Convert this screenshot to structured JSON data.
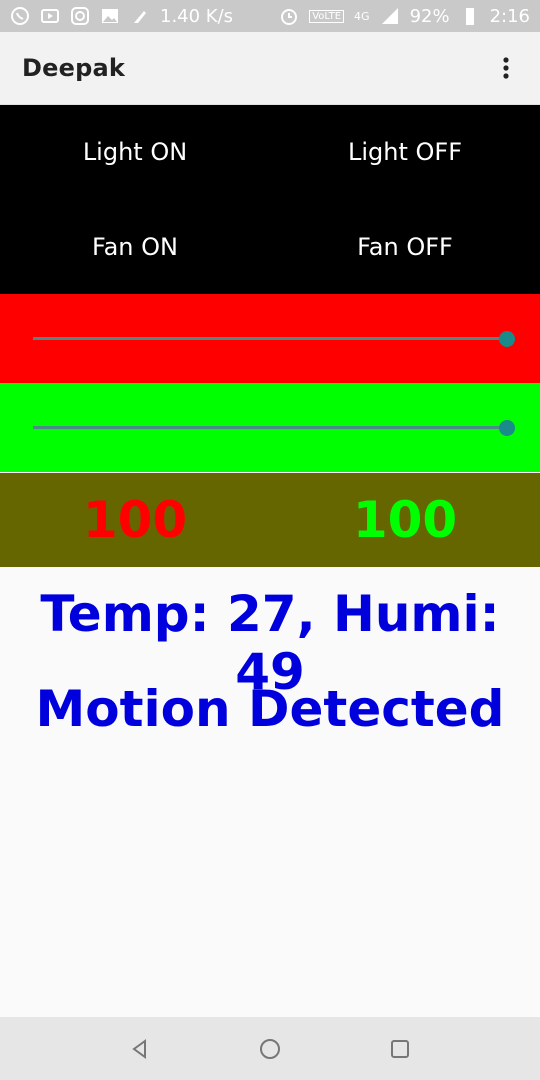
{
  "status_bar": {
    "net_speed": "1.40 K/s",
    "volte": "VoLTE",
    "network": "4G",
    "battery": "92%",
    "time": "2:16",
    "icons_left": [
      "whatsapp-icon",
      "youtube-icon",
      "instagram-icon",
      "gallery-icon",
      "cleaner-icon"
    ],
    "icons_right": [
      "alarm-icon",
      "volte-icon",
      "signal-icon",
      "battery-icon"
    ]
  },
  "app_bar": {
    "title": "Deepak"
  },
  "controls": {
    "light_on": "Light ON",
    "light_off": "Light OFF",
    "fan_on": "Fan ON",
    "fan_off": "Fan OFF"
  },
  "sliders": {
    "red": {
      "value": 100,
      "max": 100,
      "color": "#ff0000"
    },
    "green": {
      "value": 100,
      "max": 100,
      "color": "#00ff00"
    }
  },
  "values": {
    "red_value": "100",
    "green_value": "100",
    "red_color": "#ff0000",
    "green_color": "#00ff00",
    "band_color": "#666600"
  },
  "info": {
    "temp_humi": "Temp: 27, Humi: 49",
    "motion": "Motion Detected",
    "color": "#0000dd"
  },
  "navbar": {
    "icons": [
      "back-icon",
      "home-icon",
      "recents-icon"
    ]
  }
}
